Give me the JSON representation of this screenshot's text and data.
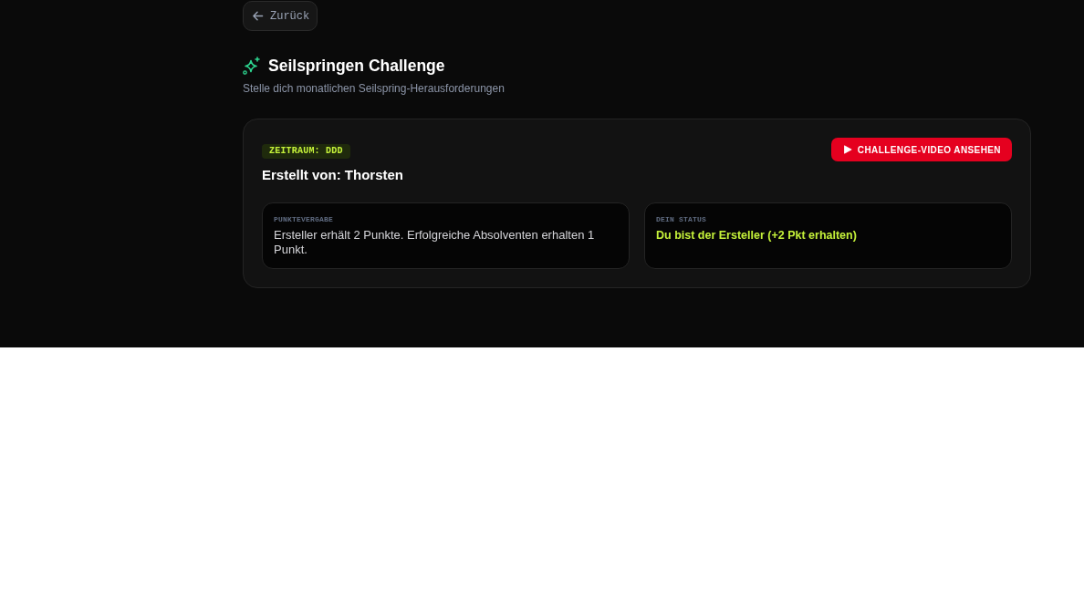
{
  "back_button": {
    "label": "Zurück"
  },
  "header": {
    "title": "Seilspringen Challenge",
    "subtitle": "Stelle dich monatlichen Seilspring-Herausforderungen"
  },
  "challenge": {
    "period_badge": "ZEITRAUM: DDD",
    "created_by": "Erstellt von: Thorsten",
    "video_button": "CHALLENGE-VIDEO ANSEHEN",
    "info_panels": [
      {
        "kind": "text",
        "label": "PUNKTEVERGABE",
        "text": "Ersteller erhält 2 Punkte. Erfolgreiche Absolventen erhalten 1 Punkt."
      },
      {
        "kind": "status",
        "label": "DEIN STATUS",
        "text": "Du bist der Ersteller (+2 Pkt erhalten)"
      }
    ]
  }
}
